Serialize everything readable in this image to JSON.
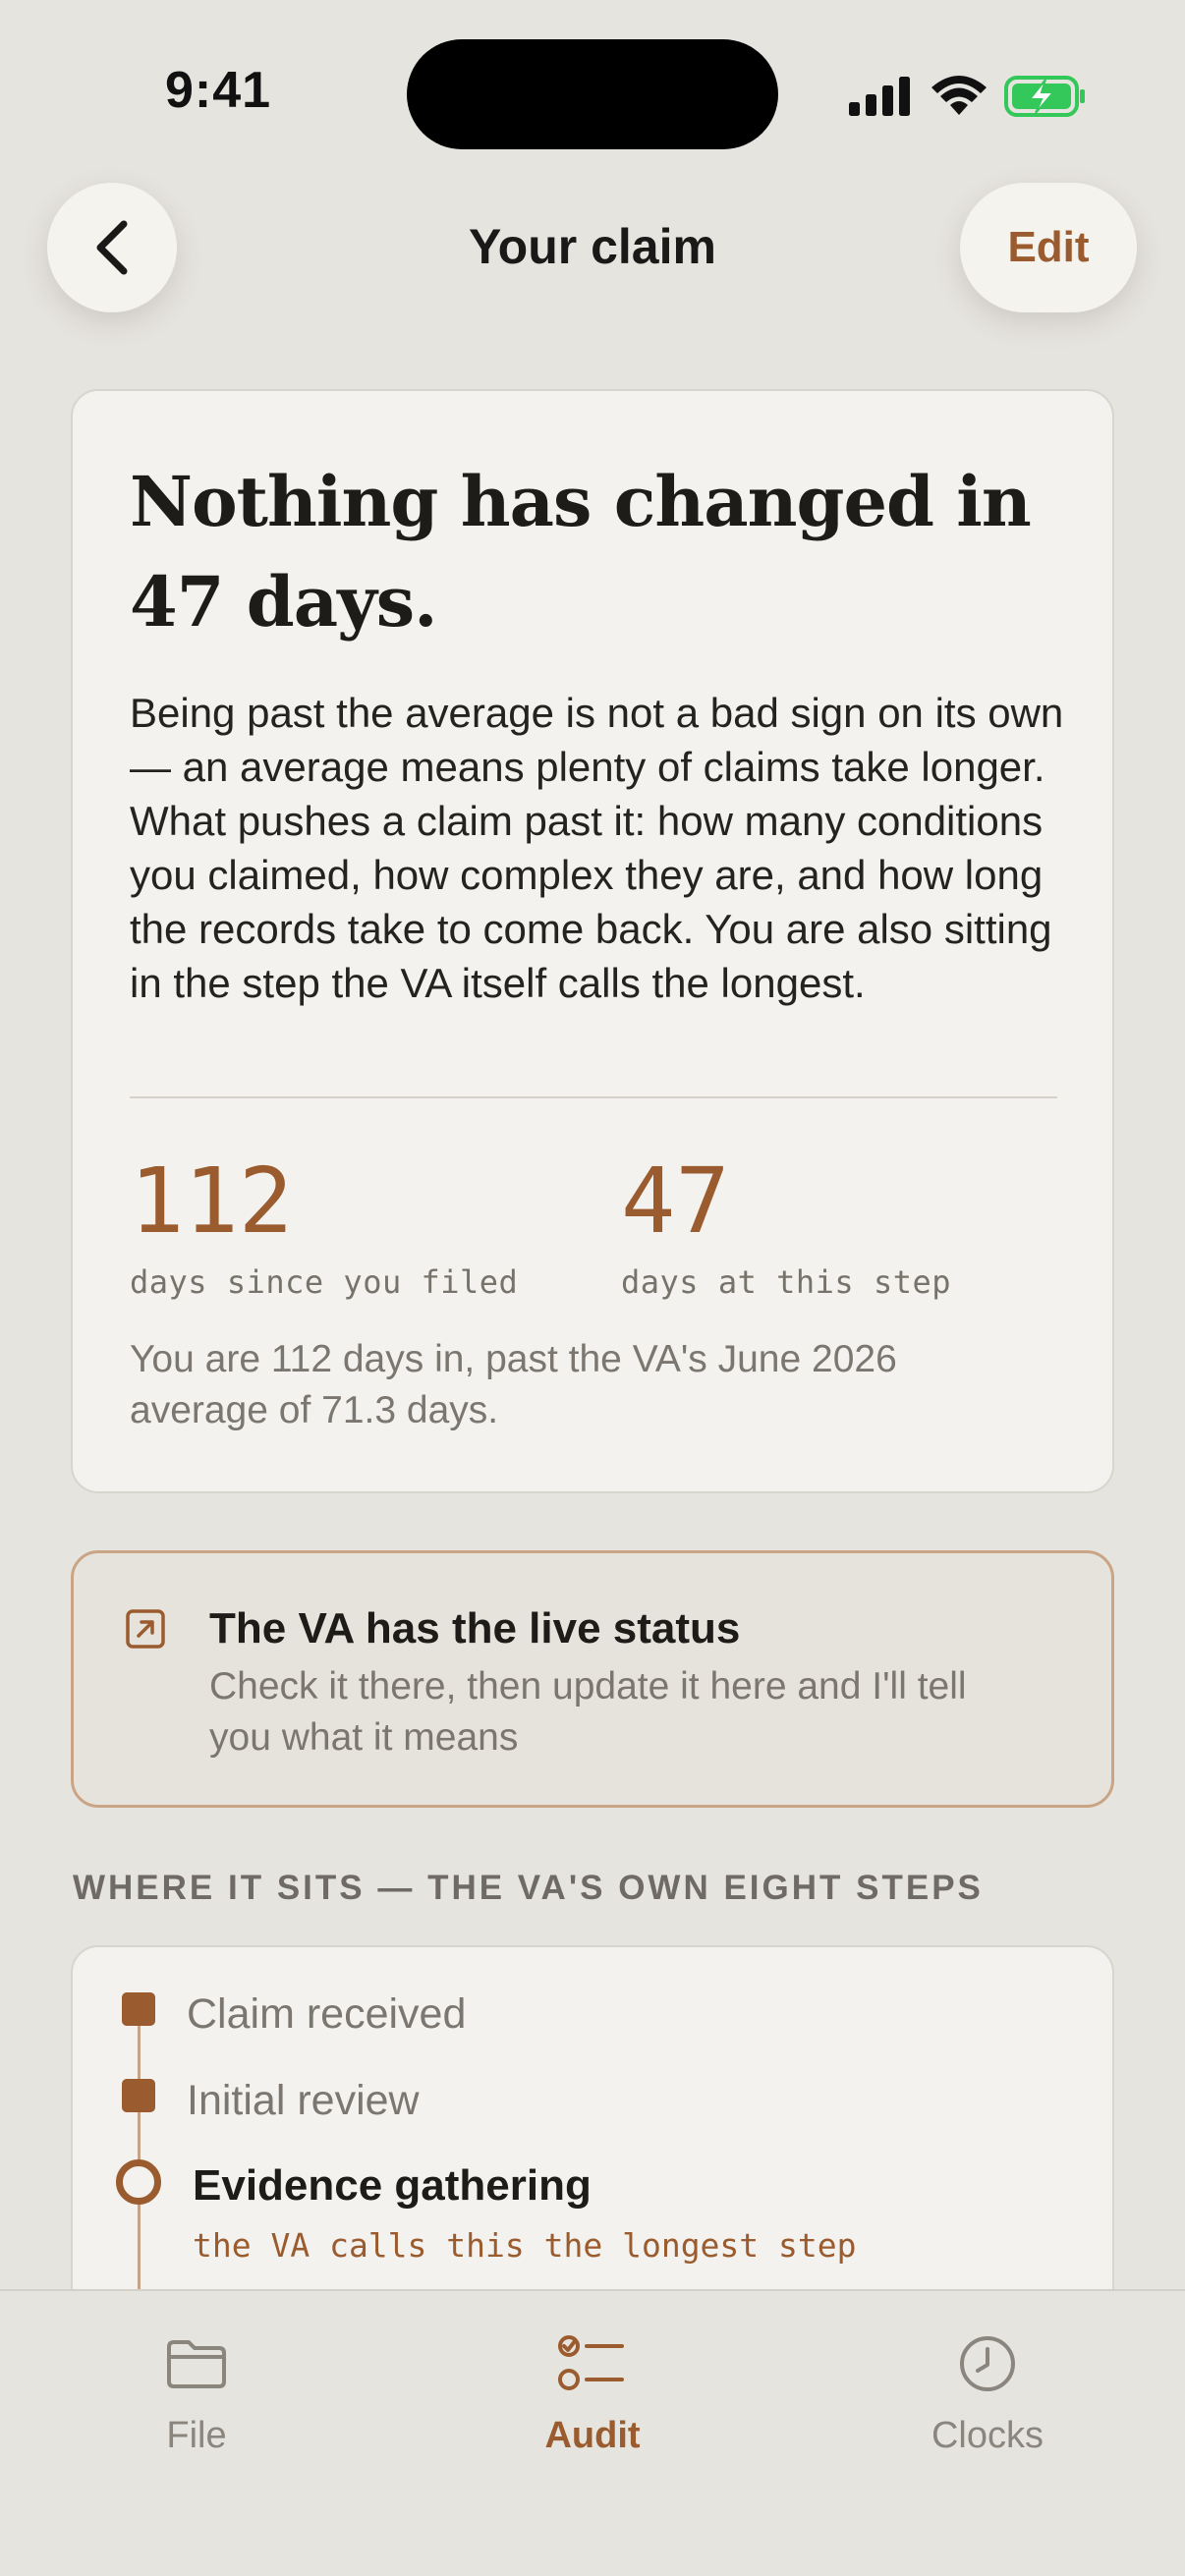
{
  "status_bar": {
    "time": "9:41"
  },
  "nav": {
    "title": "Your claim",
    "edit_label": "Edit"
  },
  "summary_card": {
    "headline": "Nothing has changed in 47 days.",
    "body": "Being past the average is not a bad sign on its own — an average means plenty of claims take longer. What pushes a claim past it: how many conditions you claimed, how complex they are, and how long the records take to come back. You are also sitting in the step the VA itself calls the longest.",
    "stats": [
      {
        "value": "112",
        "label": "days since you filed"
      },
      {
        "value": "47",
        "label": "days at this step"
      }
    ],
    "note": "You are 112 days in, past the VA's June 2026 average of 71.3 days."
  },
  "va_callout": {
    "title": "The VA has the live status",
    "subtitle": "Check it there, then update it here and I'll tell you what it means"
  },
  "steps_section": {
    "label": "WHERE IT SITS — THE VA'S OWN EIGHT STEPS",
    "steps": [
      {
        "label": "Claim received",
        "state": "done"
      },
      {
        "label": "Initial review",
        "state": "done"
      },
      {
        "label": "Evidence gathering",
        "state": "current",
        "note": "the VA calls this the longest step"
      }
    ]
  },
  "tabbar": {
    "tabs": [
      {
        "label": "File",
        "icon": "folder-icon",
        "active": false
      },
      {
        "label": "Audit",
        "icon": "checklist-icon",
        "active": true
      },
      {
        "label": "Clocks",
        "icon": "clock-icon",
        "active": false
      }
    ]
  },
  "colors": {
    "accent": "#9a5b2e",
    "background": "#e6e4df",
    "card": "#f3f2ee",
    "battery": "#34c759"
  }
}
